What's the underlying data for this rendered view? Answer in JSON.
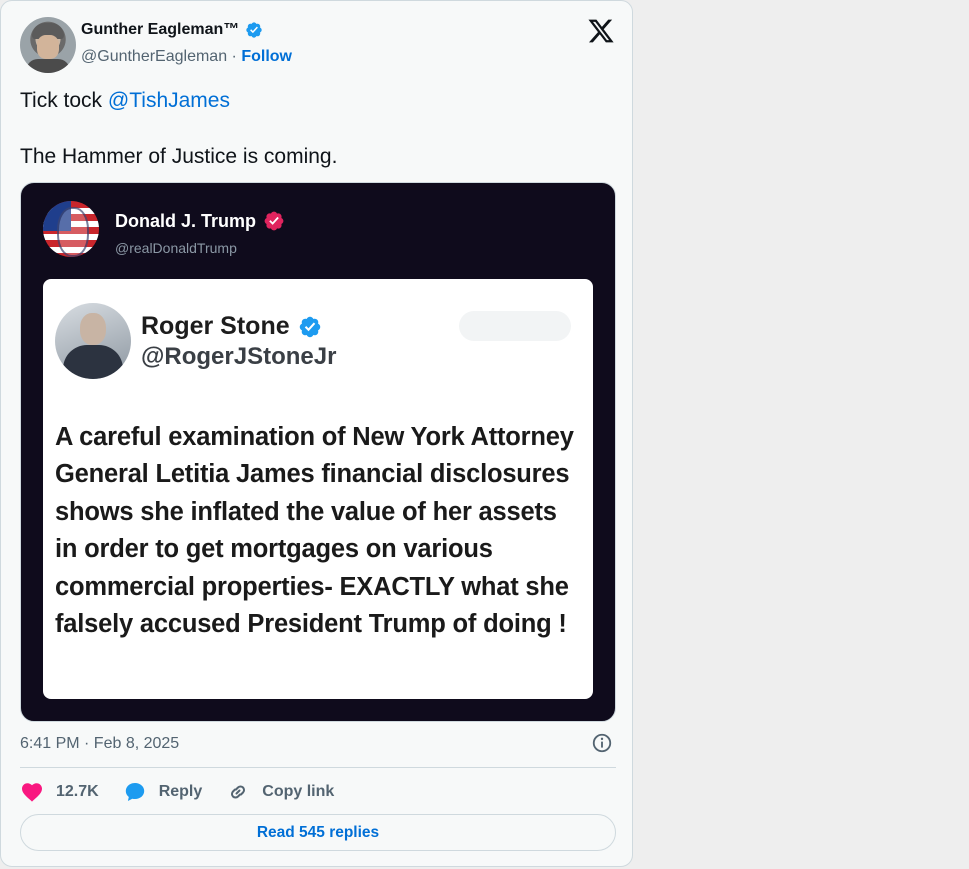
{
  "author": {
    "name": "Gunther Eagleman™",
    "handle": "@GuntherEagleman",
    "separator": " · ",
    "follow_label": "Follow"
  },
  "tweet": {
    "line1_prefix": "Tick tock ",
    "line1_mention": "@TishJames",
    "line2": "The Hammer of Justice is coming."
  },
  "media": {
    "poster_name": "Donald J. Trump",
    "poster_handle": "@realDonaldTrump",
    "quoted": {
      "name": "Roger Stone",
      "handle": "@RogerJStoneJr",
      "text": "A careful examination of New York Attorney General Letitia James financial disclosures shows she inflated the value of her assets in order to get mortgages on various commercial properties- EXACTLY what she falsely accused President Trump of doing !"
    }
  },
  "meta": {
    "timestamp": "6:41 PM · Feb 8, 2025"
  },
  "actions": {
    "like_count": "12.7K",
    "reply_label": "Reply",
    "copy_label": "Copy link"
  },
  "footer": {
    "read_replies": "Read 545 replies"
  },
  "colors": {
    "accent": "#006fd6",
    "verified_blue": "#1d9bf0",
    "verified_pink": "#e0245e",
    "like_red": "#f91880",
    "media_bg": "#0f0b1c"
  },
  "icons": [
    "verified-badge-icon",
    "x-logo-icon",
    "info-icon",
    "heart-icon",
    "reply-bubble-icon",
    "link-icon"
  ]
}
